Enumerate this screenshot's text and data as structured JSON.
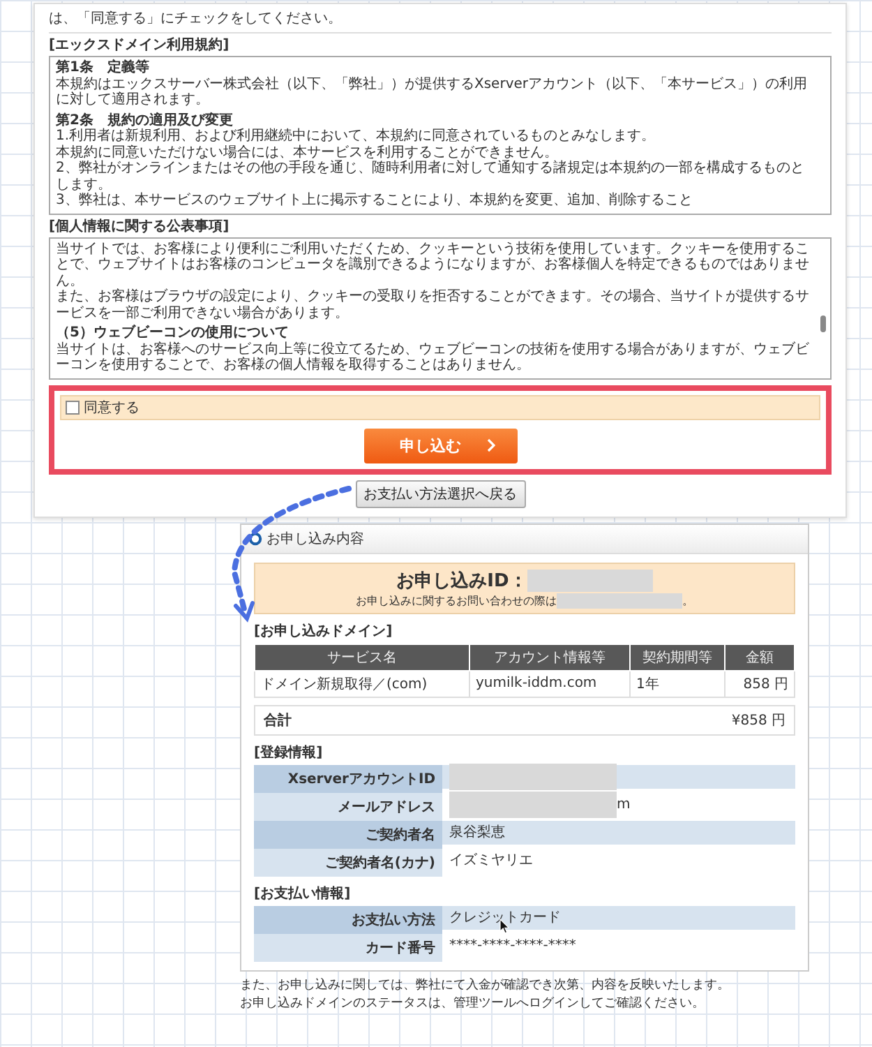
{
  "terms_page": {
    "intro": "は、「同意する」にチェックをしてください。",
    "sections": [
      {
        "heading": "[エックスドメイン利用規約]",
        "paragraphs": [
          {
            "kind": "article",
            "text": "第1条　定義等"
          },
          {
            "kind": "text",
            "text": "本規約はエックスサーバー株式会社（以下、「弊社」）が提供するXserverアカウント（以下、「本サービス」）の利用に対して適用されます。"
          },
          {
            "kind": "article",
            "text": "第2条　規約の適用及び変更"
          },
          {
            "kind": "text",
            "text": "1.利用者は新規利用、および利用継続中において、本規約に同意されているものとみなします。"
          },
          {
            "kind": "text",
            "text": "本規約に同意いただけない場合には、本サービスを利用することができません。"
          },
          {
            "kind": "text",
            "text": "2、弊社がオンラインまたはその他の手段を通じ、随時利用者に対して通知する諸規定は本規約の一部を構成するものとします。"
          },
          {
            "kind": "text",
            "text": "3、弊社は、本サービスのウェブサイト上に掲示することにより、本規約を変更、追加、削除すること"
          }
        ]
      },
      {
        "heading": "[個人情報に関する公表事項]",
        "paragraphs": [
          {
            "kind": "text",
            "text": "当サイトでは、お客様により便利にご利用いただくため、クッキーという技術を使用しています。クッキーを使用することで、ウェブサイトはお客様のコンピュータを識別できるようになりますが、お客様個人を特定できるものではありません。"
          },
          {
            "kind": "text",
            "text": "また、お客様はブラウザの設定により、クッキーの受取りを拒否することができます。その場合、当サイトが提供するサービスを一部ご利用できない場合があります。"
          },
          {
            "kind": "article",
            "text": "（5）ウェブビーコンの使用について"
          },
          {
            "kind": "text",
            "text": "当サイトは、お客様へのサービス向上等に役立てるため、ウェブビーコンの技術を使用する場合がありますが、ウェブビーコンを使用することで、お客様の個人情報を取得することはありません。"
          }
        ]
      }
    ],
    "agree": {
      "label": "同意する",
      "checked": false
    },
    "submit_button": "申し込む",
    "back_button": "お支払い方法選択へ戻る"
  },
  "order_page": {
    "title": "お申し込み内容",
    "id_label": "お申し込みID：",
    "inquiry_text": "お申し込みに関するお問い合わせの際は",
    "inquiry_end": "。",
    "domain_heading": "[お申し込みドメイン]",
    "columns": [
      "サービス名",
      "アカウント情報等",
      "契約期間等",
      "金額"
    ],
    "rows": [
      [
        "ドメイン新規取得／(com)",
        "yumilk-iddm.com",
        "1年",
        "858 円"
      ]
    ],
    "total_label": "合計",
    "total_value": "¥858 円",
    "registration_heading": "[登録情報]",
    "registration": [
      {
        "label": "XserverアカウントID",
        "redacted": true
      },
      {
        "label": "メールアドレス",
        "redacted": true,
        "value": "m"
      },
      {
        "label": "ご契約者名",
        "value": "泉谷梨恵"
      },
      {
        "label": "ご契約者名(カナ)",
        "value": "イズミヤリエ"
      }
    ],
    "payment_heading": "[お支払い情報]",
    "payment": [
      {
        "label": "お支払い方法",
        "value": "クレジットカード"
      },
      {
        "label": "カード番号",
        "value": "****-****-****-****"
      }
    ]
  },
  "footer": [
    "また、お申し込みに関しては、弊社にて入金が確認でき次第、内容を反映いたします。",
    "お申し込みドメインのステータスは、管理ツールへログインしてご確認ください。"
  ]
}
